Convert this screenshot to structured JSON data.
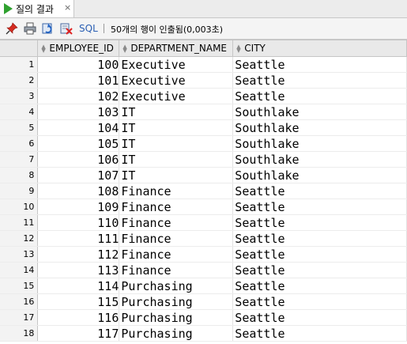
{
  "tab": {
    "title": "질의 결과",
    "close": "×"
  },
  "toolbar": {
    "icons": [
      "pin-icon",
      "print-icon",
      "refresh-icon",
      "clear-icon"
    ],
    "sql_label": "SQL",
    "status": "50개의 행이 인출됨(0,003초)"
  },
  "table": {
    "columns": [
      "EMPLOYEE_ID",
      "DEPARTMENT_NAME",
      "CITY"
    ],
    "rows": [
      {
        "n": "1",
        "id": "100",
        "dept": "Executive",
        "city": "Seattle"
      },
      {
        "n": "2",
        "id": "101",
        "dept": "Executive",
        "city": "Seattle"
      },
      {
        "n": "3",
        "id": "102",
        "dept": "Executive",
        "city": "Seattle"
      },
      {
        "n": "4",
        "id": "103",
        "dept": "IT",
        "city": "Southlake"
      },
      {
        "n": "5",
        "id": "104",
        "dept": "IT",
        "city": "Southlake"
      },
      {
        "n": "6",
        "id": "105",
        "dept": "IT",
        "city": "Southlake"
      },
      {
        "n": "7",
        "id": "106",
        "dept": "IT",
        "city": "Southlake"
      },
      {
        "n": "8",
        "id": "107",
        "dept": "IT",
        "city": "Southlake"
      },
      {
        "n": "9",
        "id": "108",
        "dept": "Finance",
        "city": "Seattle"
      },
      {
        "n": "10",
        "id": "109",
        "dept": "Finance",
        "city": "Seattle"
      },
      {
        "n": "11",
        "id": "110",
        "dept": "Finance",
        "city": "Seattle"
      },
      {
        "n": "12",
        "id": "111",
        "dept": "Finance",
        "city": "Seattle"
      },
      {
        "n": "13",
        "id": "112",
        "dept": "Finance",
        "city": "Seattle"
      },
      {
        "n": "14",
        "id": "113",
        "dept": "Finance",
        "city": "Seattle"
      },
      {
        "n": "15",
        "id": "114",
        "dept": "Purchasing",
        "city": "Seattle"
      },
      {
        "n": "16",
        "id": "115",
        "dept": "Purchasing",
        "city": "Seattle"
      },
      {
        "n": "17",
        "id": "116",
        "dept": "Purchasing",
        "city": "Seattle"
      },
      {
        "n": "18",
        "id": "117",
        "dept": "Purchasing",
        "city": "Seattle"
      }
    ]
  }
}
